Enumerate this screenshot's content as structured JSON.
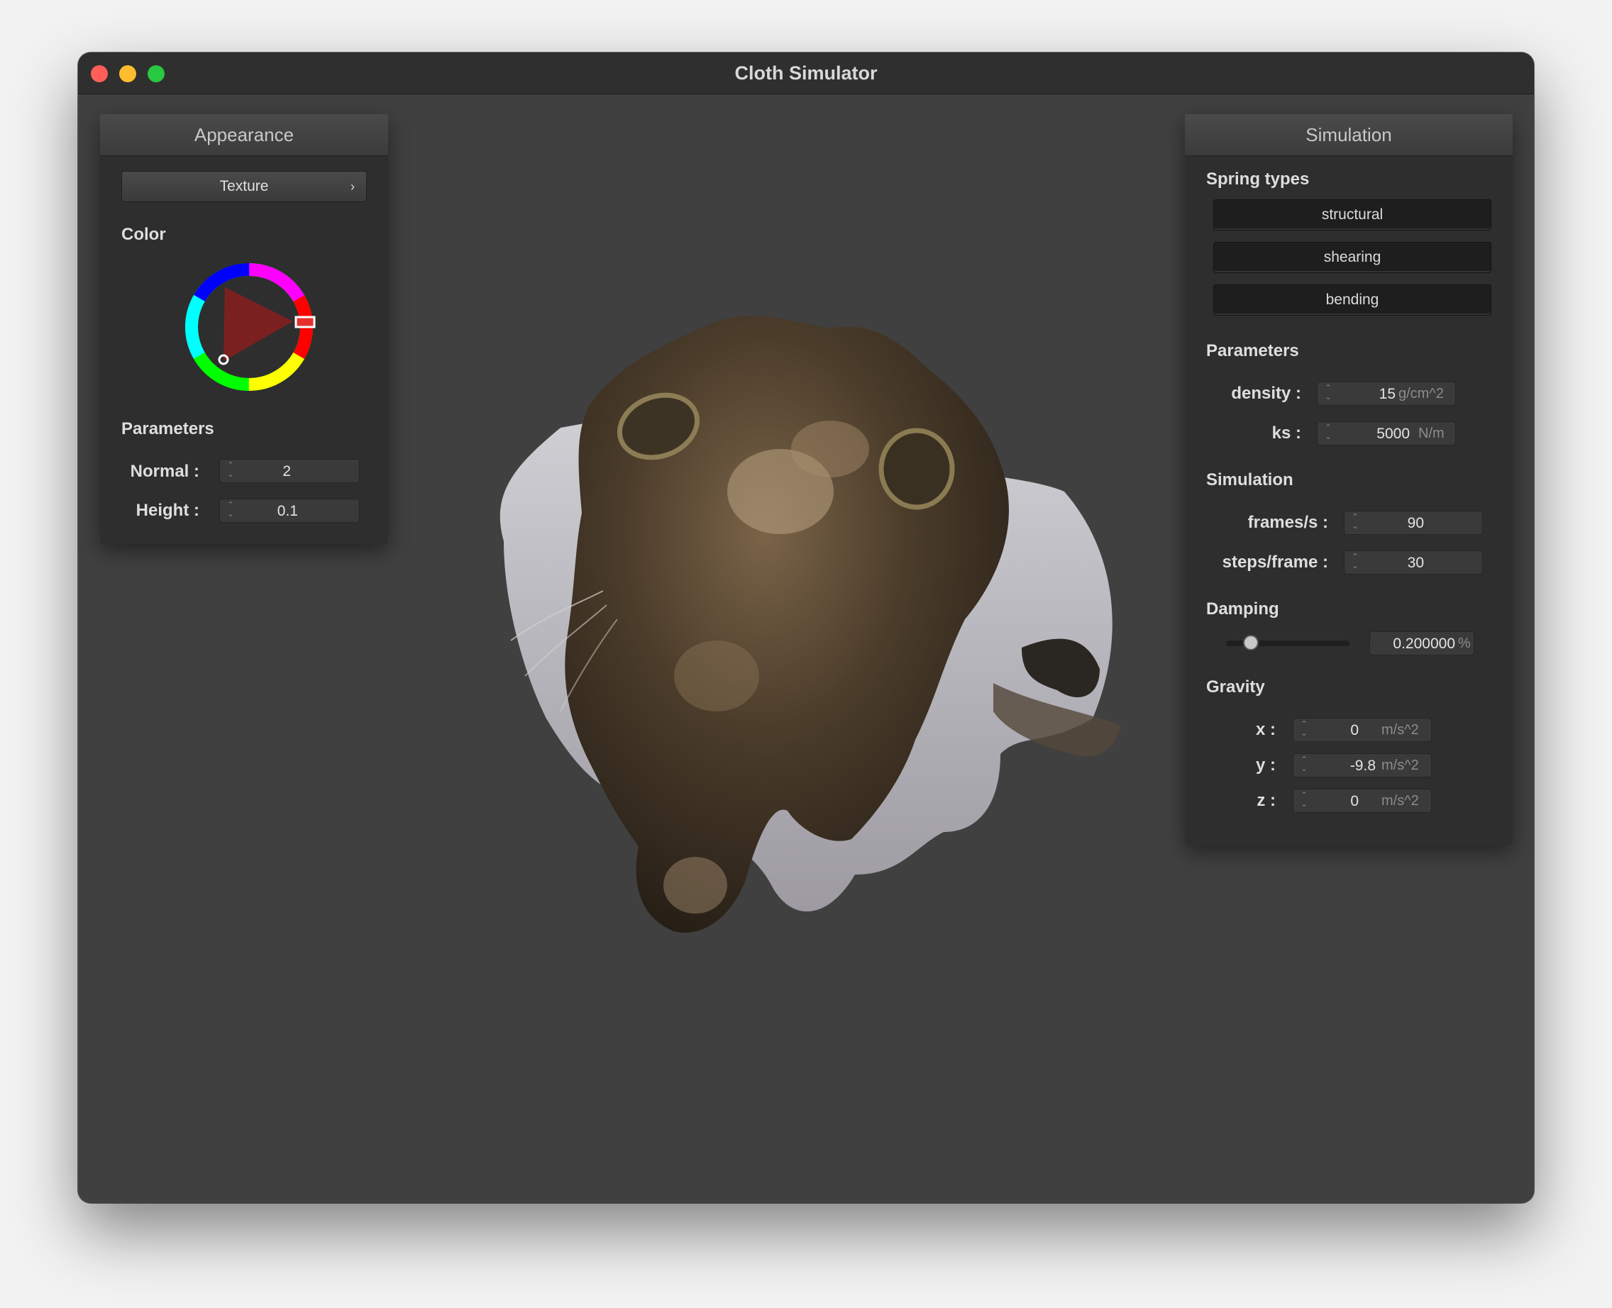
{
  "window": {
    "title": "Cloth Simulator"
  },
  "appearance": {
    "title": "Appearance",
    "texture_button": "Texture",
    "texture_chevron": "›",
    "color_label": "Color",
    "wheel_color": "#e53030",
    "parameters_label": "Parameters",
    "normal": {
      "label": "Normal :",
      "value": "2"
    },
    "height": {
      "label": "Height :",
      "value": "0.1"
    }
  },
  "simulation": {
    "title": "Simulation",
    "spring_types_label": "Spring types",
    "spring_types": [
      "structural",
      "shearing",
      "bending"
    ],
    "parameters_label": "Parameters",
    "density": {
      "label": "density :",
      "value": "15",
      "unit": "g/cm^2"
    },
    "ks": {
      "label": "ks :",
      "value": "5000",
      "unit": "N/m"
    },
    "simulation_label": "Simulation",
    "frames": {
      "label": "frames/s :",
      "value": "90"
    },
    "steps": {
      "label": "steps/frame :",
      "value": "30"
    },
    "damping_label": "Damping",
    "damping": {
      "value": "0.200000",
      "unit": "%",
      "slider_fraction": 0.2
    },
    "gravity_label": "Gravity",
    "gravity": [
      {
        "label": "x :",
        "value": "0",
        "unit": "m/s^2"
      },
      {
        "label": "y :",
        "value": "-9.8",
        "unit": "m/s^2"
      },
      {
        "label": "z :",
        "value": "0",
        "unit": "m/s^2"
      }
    ]
  },
  "colors": {
    "window_bg": "#404040",
    "panel_bg": "#2e2e2e",
    "titlebar": "#2f2f2f"
  }
}
